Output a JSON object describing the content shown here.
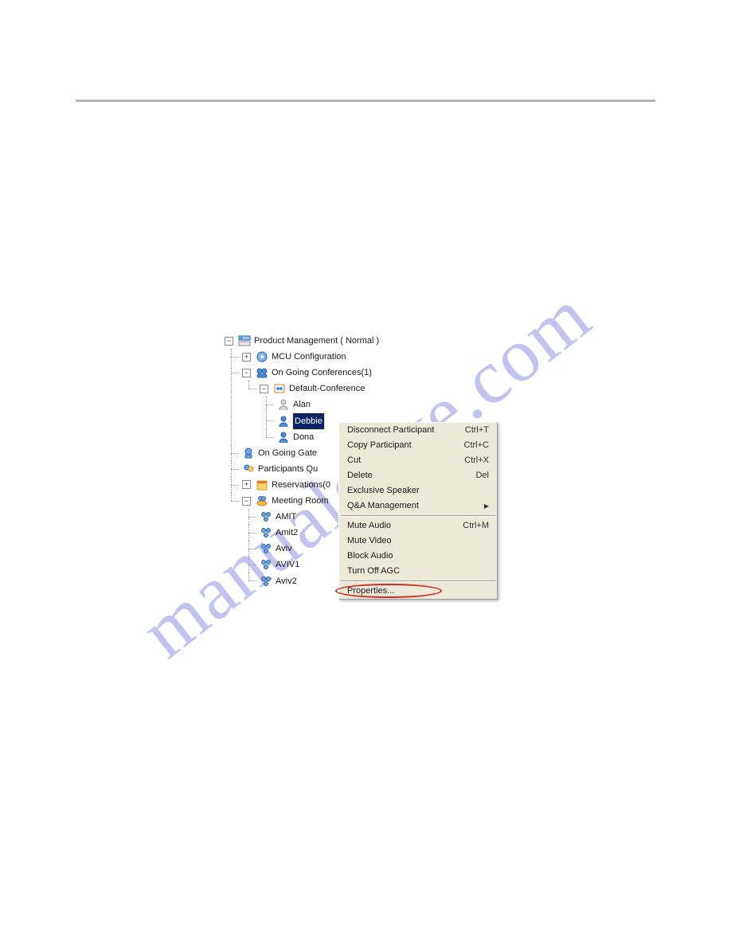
{
  "watermark": "manualslive.com",
  "tree": {
    "root": "Product Management   ( Normal )",
    "mcu": "MCU Configuration",
    "ongoing": "On Going Conferences(1)",
    "conf": "Default-Conference",
    "p1": "Alan",
    "p2": "Debbie",
    "p3": "Dona",
    "gate": "On Going Gate",
    "pqueue": "Participants Qu",
    "reservations": "Reservations(0",
    "meeting": "Meeting Room",
    "mr1": "AMIT",
    "mr2": "Amit2",
    "mr3": "Aviv",
    "mr4": "AVIV1",
    "mr5": "Aviv2"
  },
  "expanders": {
    "minus": "−",
    "plus": "+"
  },
  "menu": {
    "items": [
      {
        "label": "Disconnect Participant",
        "shortcut": "Ctrl+T",
        "arrow": false
      },
      {
        "label": "Copy Participant",
        "shortcut": "Ctrl+C",
        "arrow": false
      },
      {
        "label": "Cut",
        "shortcut": "Ctrl+X",
        "arrow": false
      },
      {
        "label": "Delete",
        "shortcut": "Del",
        "arrow": false
      },
      {
        "label": "Exclusive Speaker",
        "shortcut": "",
        "arrow": false
      },
      {
        "label": "Q&A Management",
        "shortcut": "",
        "arrow": true
      }
    ],
    "items2": [
      {
        "label": "Mute Audio",
        "shortcut": "Ctrl+M",
        "arrow": false
      },
      {
        "label": "Mute Video",
        "shortcut": "",
        "arrow": false
      },
      {
        "label": "Block Audio",
        "shortcut": "",
        "arrow": false
      },
      {
        "label": "Turn Off AGC",
        "shortcut": "",
        "arrow": false
      }
    ],
    "properties": "Properties..."
  }
}
